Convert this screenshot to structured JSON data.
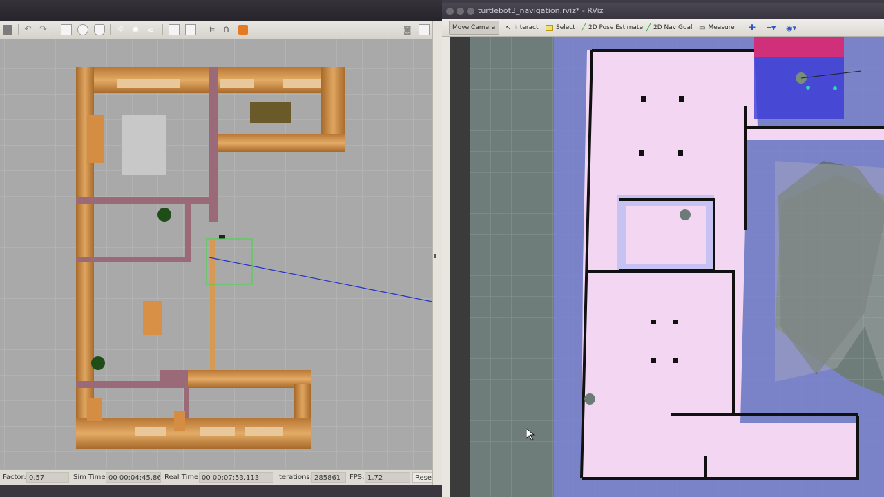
{
  "gazebo": {
    "status": {
      "factor_label": "Factor:",
      "factor_value": "0.57",
      "sim_time_label": "Sim Time:",
      "sim_time_value": "00 00:04:45.861",
      "real_time_label": "Real Time:",
      "real_time_value": "00 00:07:53.113",
      "iterations_label": "Iterations:",
      "iterations_value": "285861",
      "fps_label": "FPS:",
      "fps_value": "1.72",
      "reset_label": "Rese"
    },
    "toolbar_icons": [
      "undo-icon",
      "redo-icon",
      "box-icon",
      "sphere-icon",
      "cylinder-icon",
      "sun-icon",
      "spot-light-icon",
      "directional-light-icon",
      "copy-icon",
      "paste-icon",
      "align-icon",
      "snap-icon",
      "color-icon",
      "screenshot-icon"
    ]
  },
  "rviz": {
    "window_title": "turtlebot3_navigation.rviz* - RViz",
    "tools": {
      "move_camera": "Move Camera",
      "interact": "Interact",
      "select": "Select",
      "pose_estimate": "2D Pose Estimate",
      "nav_goal": "2D Nav Goal",
      "measure": "Measure"
    }
  },
  "colors": {
    "costmap_free": "#f3d7f2",
    "costmap_inflated": "#a8a3ef",
    "unknown": "#6e7d7a",
    "grid_bg": "#a9a9a9",
    "wood": "#c98a3e",
    "brick": "#9b6a78"
  }
}
